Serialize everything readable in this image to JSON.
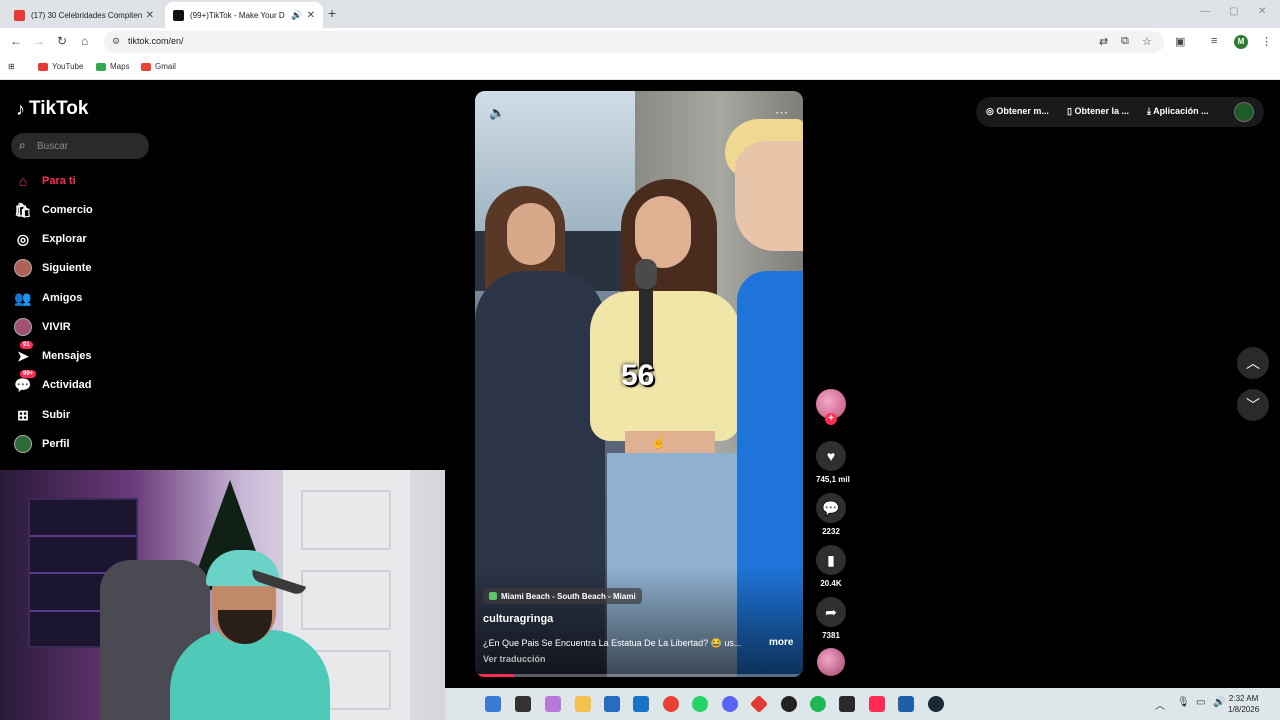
{
  "browser": {
    "tabs": [
      {
        "title": "(17) 30 Celebridades Compiten",
        "color": "#e53935"
      },
      {
        "title": "(99+)TikTok - Make Your D",
        "color": "#111111"
      }
    ],
    "url": "tiktok.com/en/",
    "bookmarks": [
      {
        "label": "YouTube",
        "color": "#e53935"
      },
      {
        "label": "Maps",
        "color": "#34a853"
      },
      {
        "label": "Gmail",
        "color": "#ea4335"
      }
    ],
    "profile_initial": "M"
  },
  "tiktok": {
    "brand": "TikTok",
    "search_placeholder": "Buscar",
    "menu": [
      {
        "label": "Para ti",
        "icon": "home-icon",
        "active": true
      },
      {
        "label": "Comercio",
        "icon": "shop-icon"
      },
      {
        "label": "Explorar",
        "icon": "compass-icon"
      },
      {
        "label": "Siguiente",
        "icon": "following-avatar-icon"
      },
      {
        "label": "Amigos",
        "icon": "friends-icon"
      },
      {
        "label": "VIVIR",
        "icon": "live-avatar-icon"
      },
      {
        "label": "Mensajes",
        "icon": "messages-icon",
        "badge": "91"
      },
      {
        "label": "Actividad",
        "icon": "activity-icon",
        "badge": "99+"
      },
      {
        "label": "Subir",
        "icon": "upload-icon"
      },
      {
        "label": "Perfil",
        "icon": "profile-icon"
      }
    ],
    "topbar": {
      "item1": "Obtener m...",
      "item2": "Obtener la ...",
      "item3": "Aplicación ..."
    },
    "video": {
      "overlay_number": "56",
      "location": "Miami Beach - South Beach - Miami",
      "username": "culturagringa",
      "caption": "¿En Que Pais Se Encuentra La Estatua De La Libertad? 😂 us...",
      "more": "more",
      "translate": "Ver traducción",
      "progress": 0.12
    },
    "actions": {
      "likes": "745,1 mil",
      "comments": "2232",
      "saves": "20.4K",
      "shares": "7381"
    }
  },
  "taskbar": {
    "time": "2:32 AM",
    "date": "1/8/2026"
  }
}
